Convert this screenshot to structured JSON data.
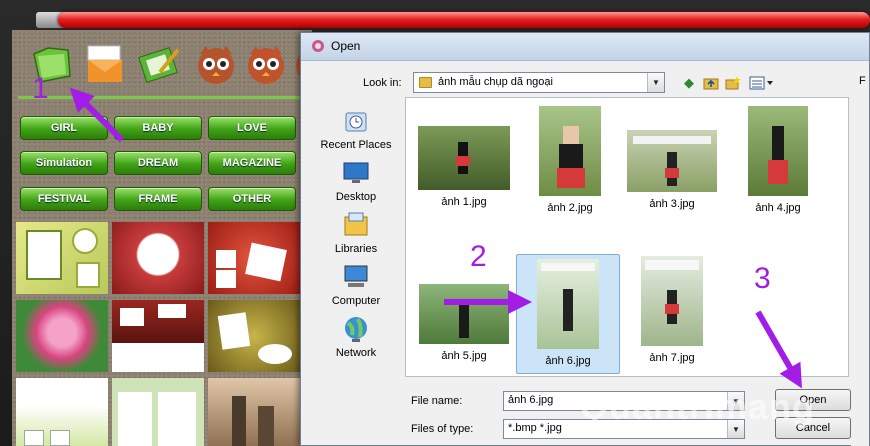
{
  "app": {
    "categories": [
      "GIRL",
      "BABY",
      "LOVE",
      "Simulation",
      "DREAM",
      "MAGAZINE",
      "FESTIVAL",
      "FRAME",
      "OTHER"
    ]
  },
  "dialog": {
    "title": "Open",
    "look_in_label": "Look in:",
    "look_in_value": "ảnh mẫu chụp dã ngoại",
    "places": [
      "Recent Places",
      "Desktop",
      "Libraries",
      "Computer",
      "Network"
    ],
    "files": [
      "ảnh 1.jpg",
      "ảnh 2.jpg",
      "ảnh 3.jpg",
      "ảnh 4.jpg",
      "ảnh 5.jpg",
      "ảnh 6.jpg",
      "ảnh 7.jpg"
    ],
    "selected_file": "ảnh 6.jpg",
    "file_name_label": "File name:",
    "file_name_value": "ảnh 6.jpg",
    "file_type_label": "Files of type:",
    "file_type_value": "*.bmp *.jpg",
    "open_button": "Open",
    "cancel_button": "Cancel",
    "side_letter": "F"
  },
  "annotations": [
    "1",
    "2",
    "3"
  ],
  "watermark": "Quantrimang",
  "colors": {
    "accent_purple": "#a21ee6",
    "button_green": "#3fa315",
    "title_red": "#e62020"
  }
}
